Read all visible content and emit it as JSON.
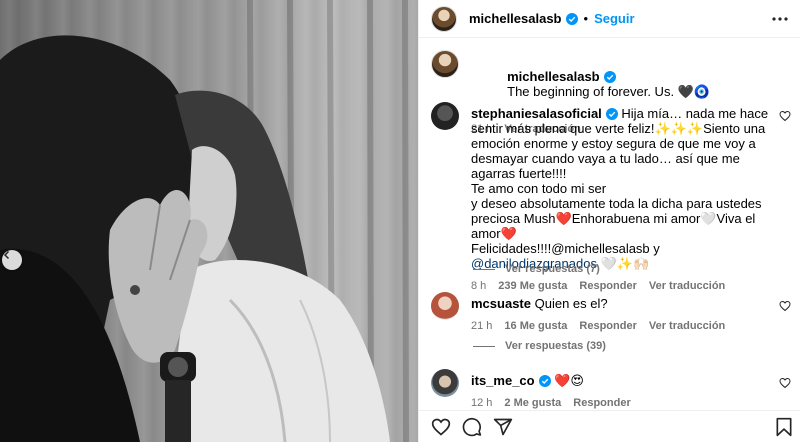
{
  "header": {
    "username": "michellesalasb",
    "separator": "•",
    "follow_label": "Seguir"
  },
  "caption": {
    "username": "michellesalasb",
    "text": "The beginning of forever. Us. 🖤🧿",
    "time": "21 h",
    "translate": "Ver traducción"
  },
  "comments": [
    {
      "username": "stephaniesalasoficial",
      "text_part1": "Hija mía… nada me hace sentir más plena que verte feliz!✨✨✨Siento una emoción enorme y estoy segura de que me voy a desmayar cuando vaya a tu lado… así que me agarras fuerte!!!!\nTe amo con todo mi ser\ny deseo absolutamente toda la dicha para ustedes preciosa Mush❤️Enhorabuena mi amor🤍Viva el amor❤️\nFelicidades!!!!@michellesalasb y ",
      "mention": "@danilodiazgranados",
      "text_part2": " 🤍✨🙌🏻",
      "time": "8 h",
      "likes": "239 Me gusta",
      "reply": "Responder",
      "translate": "Ver traducción",
      "view_replies": "Ver respuestas (7)"
    },
    {
      "username": "mcsuaste",
      "text": "Quien es el?",
      "time": "21 h",
      "likes": "16 Me gusta",
      "reply": "Responder",
      "translate": "Ver traducción",
      "view_replies": "Ver respuestas (39)"
    },
    {
      "username": "its_me_co",
      "text": "❤️😍",
      "time": "12 h",
      "likes": "2 Me gusta",
      "reply": "Responder"
    }
  ],
  "colors": {
    "accent": "#0095f6",
    "verified": "#0095f6",
    "muted": "#737373",
    "border": "#efefef"
  },
  "icons": {
    "more": "more-horizontal-icon",
    "like": "heart-icon",
    "comment": "comment-icon",
    "share": "send-icon",
    "save": "bookmark-icon",
    "carousel_prev": "chevron-left-icon",
    "verified": "verified-badge-icon"
  }
}
